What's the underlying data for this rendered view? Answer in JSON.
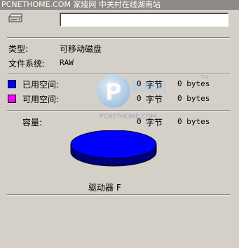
{
  "top_watermark": "PCNETHOME.COM 家绫网 中关村在线湖南站",
  "icons": {
    "drive": "removable-drive-icon",
    "used_swatch": "#0000ff",
    "free_swatch": "#ff00ff"
  },
  "drive_name": {
    "value": ""
  },
  "type": {
    "label": "类型:",
    "value": "可移动磁盘"
  },
  "filesystem": {
    "label": "文件系统:",
    "value": "RAW"
  },
  "used_space": {
    "label": "已用空间:",
    "bytes": "0",
    "bytes_unit": "字节",
    "short": "0 bytes"
  },
  "free_space": {
    "label": "可用空间:",
    "bytes": "0",
    "bytes_unit": "字节",
    "short": "0 bytes"
  },
  "capacity": {
    "label": "容量:",
    "bytes": "0",
    "bytes_unit": "字节",
    "short": "0 bytes"
  },
  "chart_data": {
    "type": "pie",
    "categories": [
      "已用空间",
      "可用空间"
    ],
    "values": [
      0,
      0
    ],
    "colors": [
      "#0000ff",
      "#ff00ff"
    ]
  },
  "drive_label": "驱动器 F",
  "site_watermark": {
    "brand": "家绫网",
    "url": "PCNETHOME.COM",
    "tm": "TM"
  }
}
